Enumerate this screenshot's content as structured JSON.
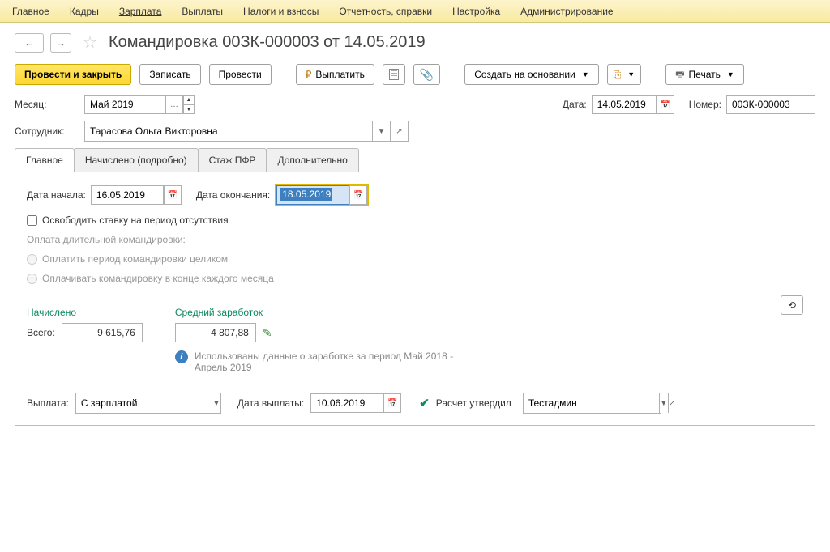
{
  "topmenu": [
    "Главное",
    "Кадры",
    "Зарплата",
    "Выплаты",
    "Налоги и взносы",
    "Отчетность, справки",
    "Настройка",
    "Администрирование"
  ],
  "topmenu_active_index": 2,
  "page_title": "Командировка 00ЗК-000003 от 14.05.2019",
  "toolbar": {
    "submit_close": "Провести и закрыть",
    "save": "Записать",
    "post": "Провести",
    "pay": "Выплатить",
    "create_based": "Создать на основании",
    "print": "Печать"
  },
  "form": {
    "month_label": "Месяц:",
    "month_value": "Май 2019",
    "date_label": "Дата:",
    "date_value": "14.05.2019",
    "number_label": "Номер:",
    "number_value": "00ЗК-000003",
    "employee_label": "Сотрудник:",
    "employee_value": "Тарасова Ольга Викторовна"
  },
  "tabs": [
    "Главное",
    "Начислено (подробно)",
    "Стаж ПФР",
    "Дополнительно"
  ],
  "tab_active_index": 0,
  "main_tab": {
    "start_date_label": "Дата начала:",
    "start_date_value": "16.05.2019",
    "end_date_label": "Дата окончания:",
    "end_date_value": "18.05.2019",
    "free_rate": "Освободить ставку на период отсутствия",
    "long_trip_header": "Оплата длительной командировки:",
    "long_trip_opt1": "Оплатить период командировки целиком",
    "long_trip_opt2": "Оплачивать командировку в конце каждого месяца",
    "accrued": "Начислено",
    "avg_salary": "Средний заработок",
    "total_label": "Всего:",
    "total_value": "9 615,76",
    "avg_value": "4 807,88",
    "info_text": "Использованы данные о заработке за период Май 2018 - Апрель 2019"
  },
  "bottom": {
    "payout_label": "Выплата:",
    "payout_value": "С зарплатой",
    "payout_date_label": "Дата выплаты:",
    "payout_date_value": "10.06.2019",
    "approve_label": "Расчет утвердил",
    "approver": "Тестадмин"
  }
}
